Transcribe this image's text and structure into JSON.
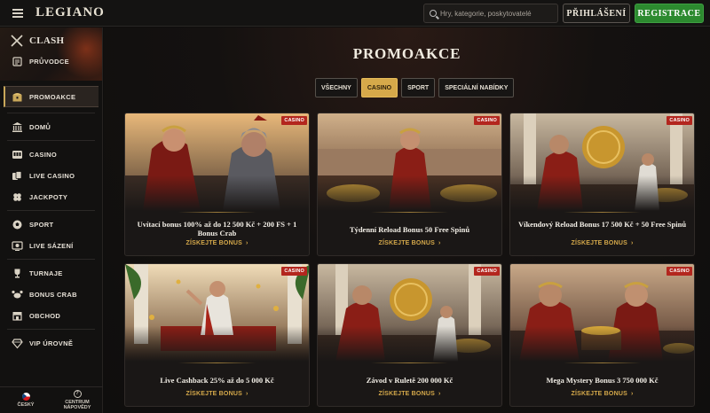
{
  "header": {
    "logo": "LEGIANO",
    "search_placeholder": "Hry, kategorie, poskytovatelé",
    "login_label": "PŘIHLÁŠENÍ",
    "register_label": "REGISTRACE"
  },
  "sidebar": {
    "clash": "CLASH",
    "items": [
      {
        "label": "PRŮVODCE",
        "icon": "scroll-icon"
      },
      {
        "label": "PROMOAKCE",
        "icon": "treasure-chest-icon",
        "active": true
      },
      {
        "label": "DOMŮ",
        "icon": "temple-icon"
      },
      {
        "label": "CASINO",
        "icon": "slot-icon"
      },
      {
        "label": "LIVE CASINO",
        "icon": "cards-icon"
      },
      {
        "label": "JACKPOTY",
        "icon": "clover-icon"
      },
      {
        "label": "SPORT",
        "icon": "ball-icon"
      },
      {
        "label": "LIVE SÁZENÍ",
        "icon": "live-bet-icon"
      },
      {
        "label": "TURNAJE",
        "icon": "trophy-icon"
      },
      {
        "label": "BONUS CRAB",
        "icon": "crab-icon"
      },
      {
        "label": "OBCHOD",
        "icon": "shop-icon"
      },
      {
        "label": "VIP ÚROVNĚ",
        "icon": "diamond-icon"
      }
    ],
    "footer": {
      "language": "ČESKÝ",
      "help": "CENTRUM NÁPOVĚDY"
    }
  },
  "main": {
    "title": "PROMOAKCE",
    "filters": [
      {
        "label": "VŠECHNY",
        "active": false
      },
      {
        "label": "CASINO",
        "active": true
      },
      {
        "label": "SPORT",
        "active": false
      },
      {
        "label": "SPECIÁLNÍ NABÍDKY",
        "active": false
      }
    ],
    "cta_label": "ZÍSKEJTE BONUS",
    "badge_label": "CASINO",
    "cards": [
      {
        "title": "Uvítací bonus 100% až do 12 500 Kč + 200 FS + 1 Bonus Crab",
        "scene": "warrior-duel"
      },
      {
        "title": "Týdenní Reload Bonus 50 Free Spinů",
        "scene": "emperor-gold"
      },
      {
        "title": "Víkendový Reload Bonus 17 500 Kč + 50 Free Spinů",
        "scene": "shield-offering"
      },
      {
        "title": "Live Cashback 25% až do 5 000 Kč",
        "scene": "caesar-rain"
      },
      {
        "title": "Závod v Ruletě 200 000 Kč",
        "scene": "shield-offering-2"
      },
      {
        "title": "Mega Mystery Bonus 3 750 000 Kč",
        "scene": "treasure-men"
      }
    ]
  },
  "colors": {
    "accent_gold": "#d6a94a",
    "register_green": "#2c8a2f",
    "badge_red": "#b3261e"
  }
}
